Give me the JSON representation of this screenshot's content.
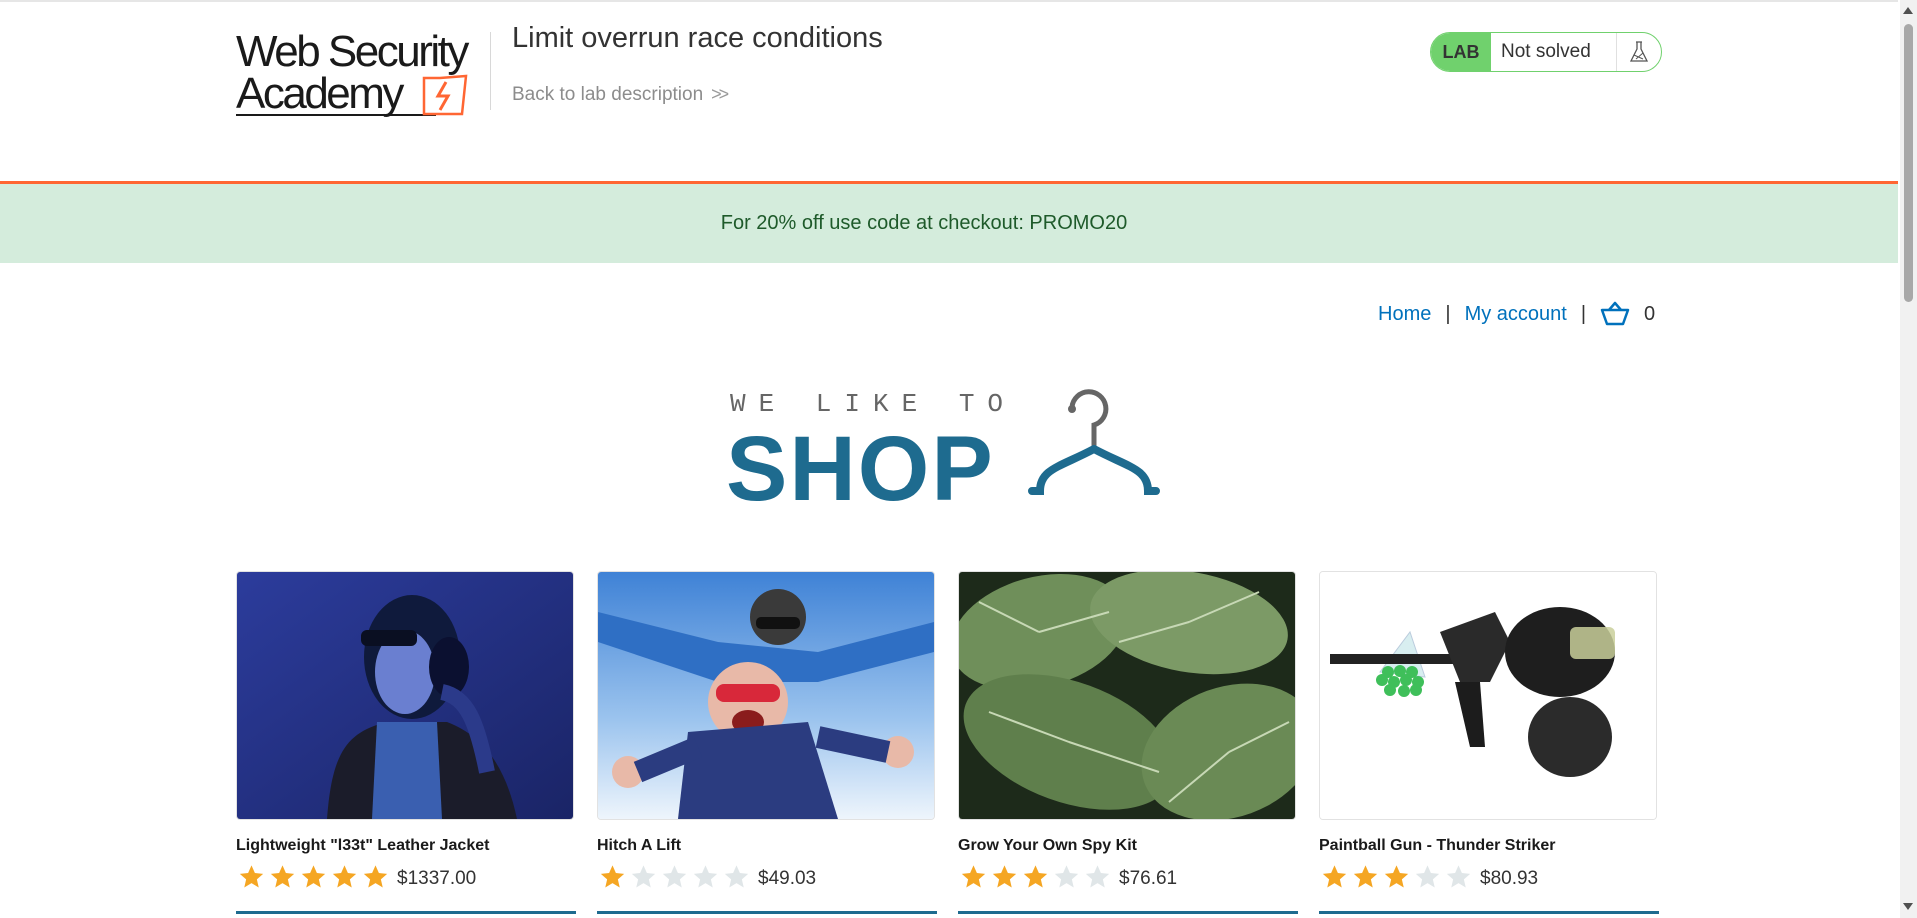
{
  "header": {
    "logo": {
      "line1": "Web Security",
      "line2": "Academy"
    },
    "lab_title": "Limit overrun race conditions",
    "back_link": "Back to lab description",
    "status": {
      "badge": "LAB",
      "text": "Not solved",
      "icon": "flask-icon"
    }
  },
  "promo": {
    "text": "For 20% off use code at checkout: PROMO20"
  },
  "nav": {
    "home": "Home",
    "sep1": "|",
    "my_account": "My account",
    "sep2": "|",
    "cart_icon": "basket-icon",
    "cart_count": "0"
  },
  "hero": {
    "tagline": "WE LIKE TO",
    "title": "SHOP",
    "icon": "hanger-icon"
  },
  "products": [
    {
      "name": "Lightweight \"l33t\" Leather Jacket",
      "rating": 5,
      "price": "$1337.00",
      "image": "woman-with-headphones"
    },
    {
      "name": "Hitch A Lift",
      "rating": 1,
      "price": "$49.03",
      "image": "tandem-skydivers"
    },
    {
      "name": "Grow Your Own Spy Kit",
      "rating": 3,
      "price": "$76.61",
      "image": "green-leaves"
    },
    {
      "name": "Paintball Gun - Thunder Striker",
      "rating": 3,
      "price": "$80.93",
      "image": "paintball-gun"
    }
  ],
  "colors": {
    "accent": "#ff6633",
    "lab_green": "#70d16d",
    "promo_bg": "#d4ecdc",
    "link": "#0071bc",
    "brand_blue": "#1e6b8f",
    "star": "#f5a623",
    "star_empty": "#e0e6e8"
  }
}
